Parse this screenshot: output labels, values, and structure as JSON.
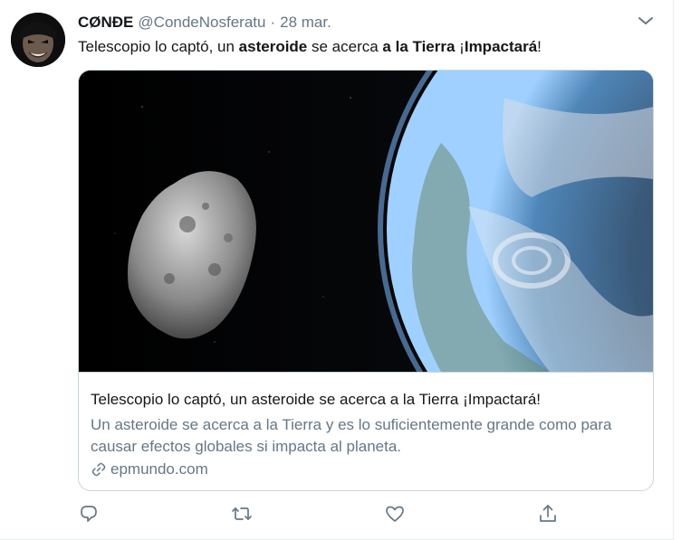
{
  "tweet": {
    "display_name": "CØNÐE",
    "handle": "@CondeNosferatu",
    "separator": "·",
    "date": "28 mar.",
    "text": {
      "part1": "Telescopio lo captó, un ",
      "bold1": "asteroide",
      "part2": " se acerca ",
      "bold2": "a la Tierra",
      "part3": " ¡",
      "bold3": "Impactará",
      "part4": "!"
    }
  },
  "card": {
    "title": "Telescopio lo captó, un asteroide se acerca a la Tierra ¡Impactará!",
    "description": "Un asteroide se acerca a la Tierra y es lo suficientemente grande como para causar efectos globales si impacta al planeta.",
    "domain": "epmundo.com"
  },
  "icons": {
    "caret": "chevron-down-icon",
    "reply": "reply-icon",
    "retweet": "retweet-icon",
    "like": "heart-icon",
    "share": "share-icon",
    "link": "link-icon"
  },
  "colors": {
    "text": "#14171a",
    "secondary": "#657786",
    "border": "#ccd6dd"
  }
}
